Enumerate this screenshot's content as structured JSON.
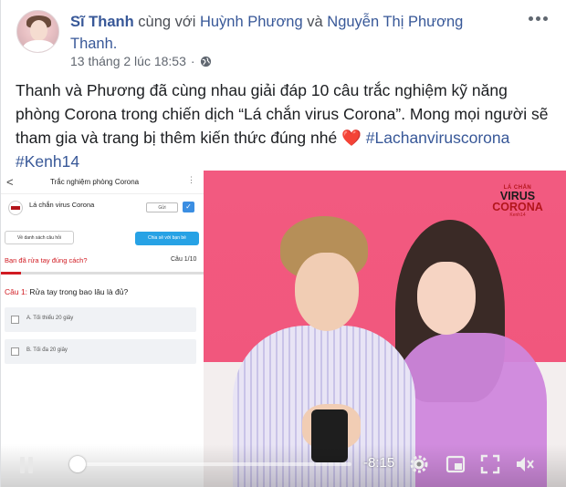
{
  "post": {
    "author": "Sĩ Thanh",
    "with_text": "cùng với",
    "tag1": "Huỳnh Phương",
    "and_text": "và",
    "tag2": "Nguyễn Thị Phương Thanh.",
    "timestamp": "13 tháng 2 lúc 18:53",
    "privacy_icon": "globe-icon",
    "more_icon": "more-options-icon",
    "text": "Thanh và Phương đã cùng nhau giải đáp 10 câu trắc nghiệm kỹ năng phòng Corona trong chiến dịch “Lá chắn virus Corona”. Mong mọi người sẽ tham gia và trang bị thêm kiến thức đúng nhé",
    "heart": "❤️",
    "hashtag1": "#Lachanviruscorona",
    "hashtag2": "#Kenh14"
  },
  "video": {
    "phone_screen": {
      "back": "<",
      "title": "Trắc nghiệm phòng Corona",
      "menu": "⋮",
      "page_name": "Lá chắn virus Corona",
      "small_button": "Gửi",
      "check": "✓",
      "left_button": "Về danh sách câu hỏi",
      "right_button": "Chia sẻ với bạn bè",
      "question_header": "Bạn đã rửa tay đúng cách?",
      "counter": "Câu 1/10",
      "progress": 0.1,
      "question_no": "Câu 1:",
      "question": "Rửa tay trong bao lâu là đủ?",
      "options": [
        "A. Tối thiểu 20 giây",
        "B. Tối đa 20 giây"
      ]
    },
    "logo": {
      "small": "LÁ CHẮN",
      "line1": "VIRUS",
      "line2": "CORONA",
      "tag": "Kenh14"
    },
    "controls": {
      "time_remaining": "-8:15",
      "progress": 0.0,
      "colors": {
        "bar": "#ffffff",
        "track": "rgba(255,255,255,0.55)"
      },
      "icons": [
        "pause-icon",
        "settings-icon",
        "picture-in-picture-icon",
        "fullscreen-icon",
        "volume-icon"
      ]
    }
  }
}
